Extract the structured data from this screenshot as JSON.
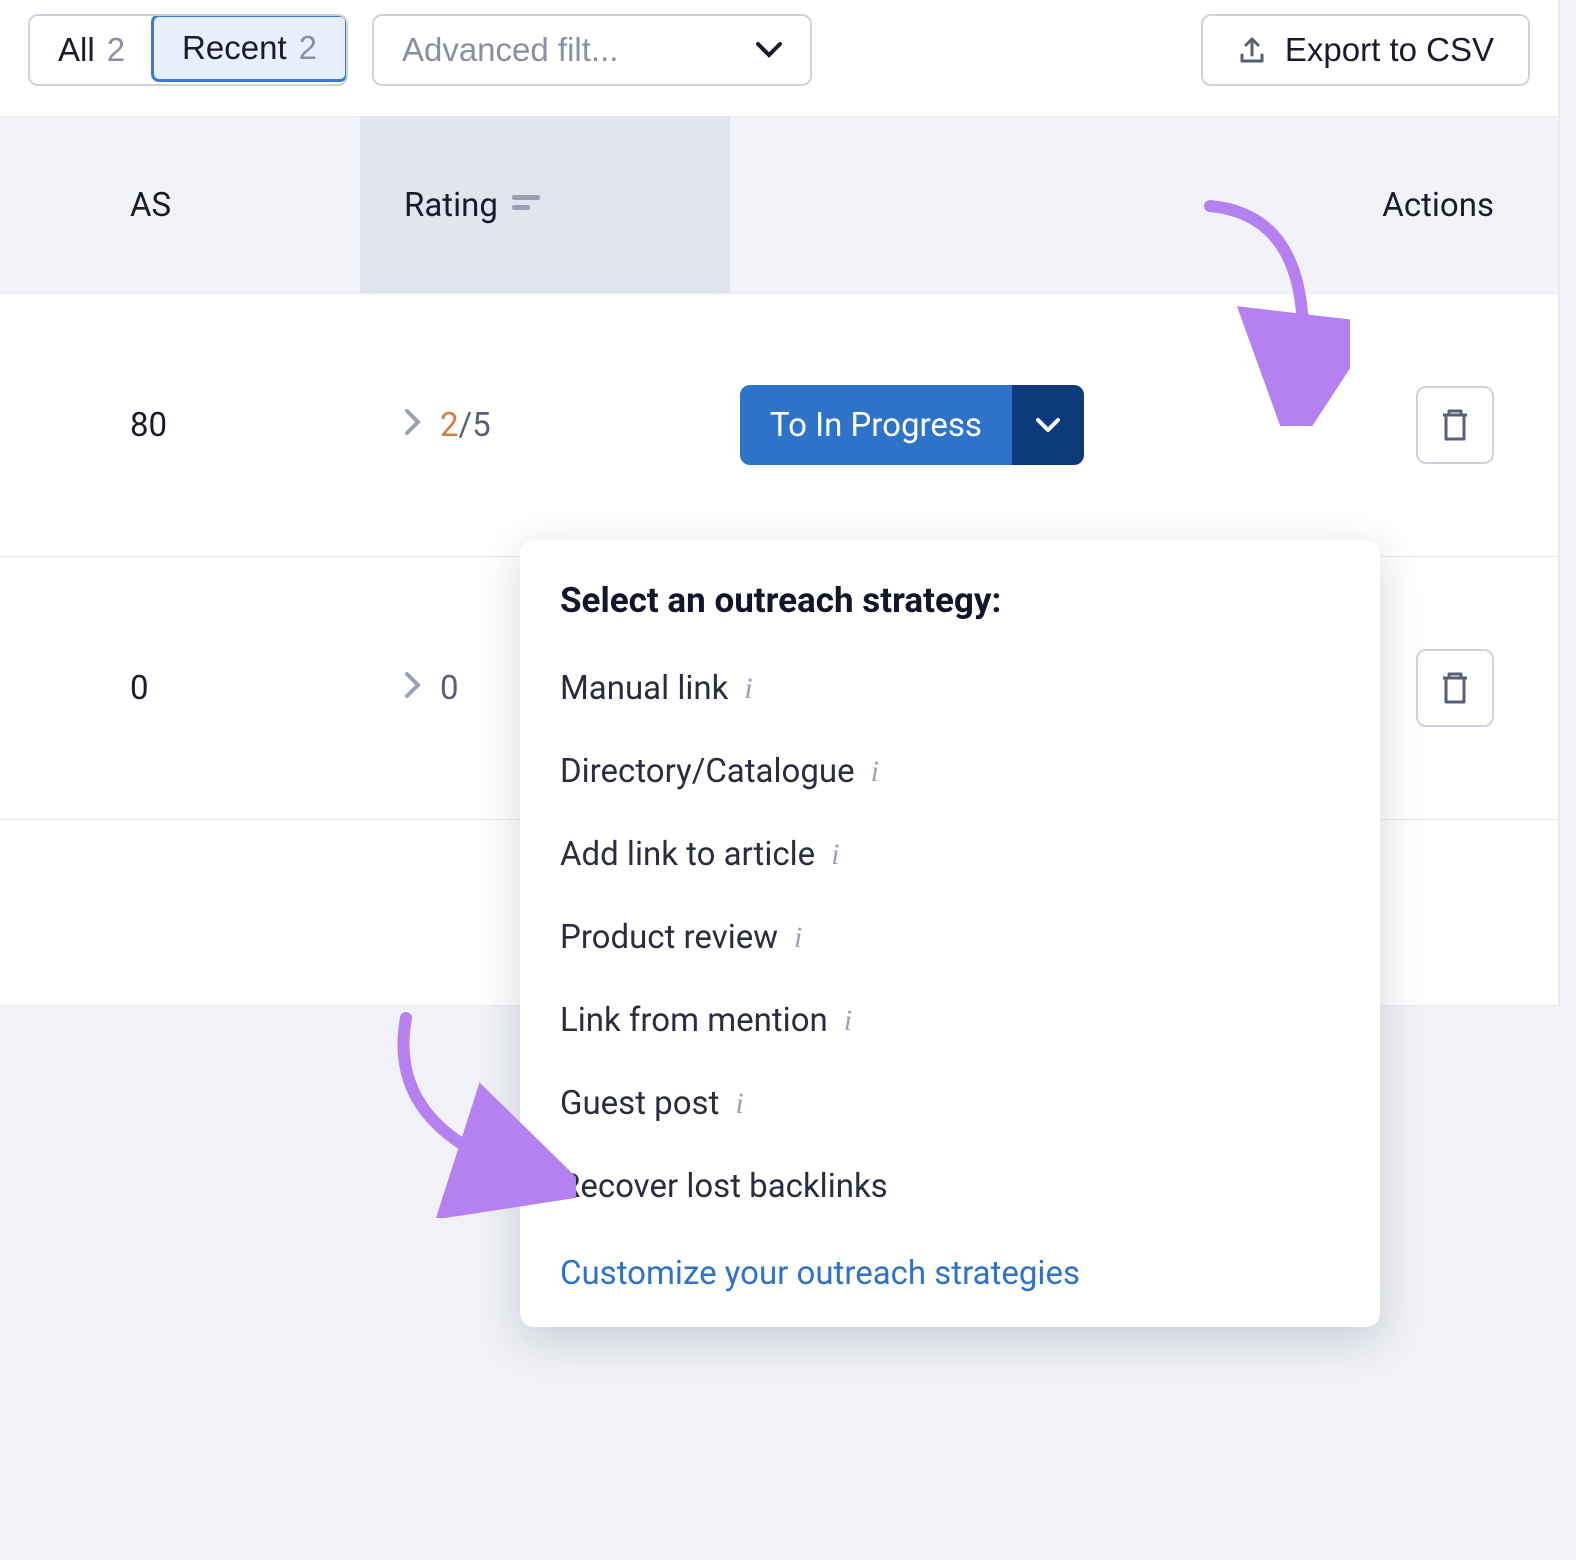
{
  "toolbar": {
    "tab_all_label": "All",
    "tab_all_count": "2",
    "tab_recent_label": "Recent",
    "tab_recent_count": "2",
    "advanced_filter_label": "Advanced filt...",
    "export_label": "Export to CSV"
  },
  "table": {
    "headers": {
      "as": "AS",
      "rating": "Rating",
      "actions": "Actions"
    },
    "rows": [
      {
        "as": "80",
        "rating_num": "2",
        "rating_den": "/5",
        "status_label": "To In Progress"
      },
      {
        "as": "0",
        "rating_num": "0",
        "rating_den": ""
      }
    ]
  },
  "dropdown": {
    "title": "Select an outreach strategy:",
    "options": [
      "Manual link",
      "Directory/Catalogue",
      "Add link to article",
      "Product review",
      "Link from mention",
      "Guest post",
      "Recover lost backlinks"
    ],
    "customize_label": "Customize your outreach strategies"
  }
}
